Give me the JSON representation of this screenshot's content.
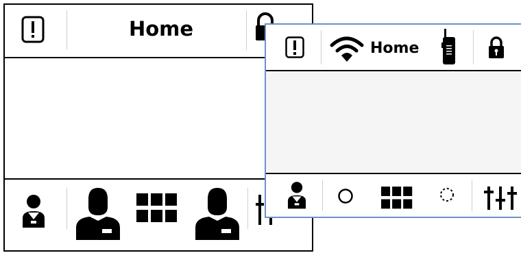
{
  "back_panel": {
    "header": {
      "title": "Home"
    },
    "icons": {
      "alert": "alert-icon",
      "lock": "lock-icon",
      "user_small": "user-icon",
      "user_large": "user-icon",
      "grid": "grid-icon",
      "sliders": "sliders-icon"
    }
  },
  "front_panel": {
    "header": {
      "title": "Home"
    },
    "icons": {
      "alert": "alert-icon",
      "wifi": "wifi-icon",
      "radio": "radio-icon",
      "lock": "lock-icon",
      "user": "user-icon",
      "circle": "circle-icon",
      "grid": "grid-icon",
      "dashed_circle": "dashed-circle-icon",
      "sliders": "sliders-icon"
    }
  },
  "colors": {
    "front_border": "#6f8fc6",
    "content_bg": "#f5f5f5"
  }
}
